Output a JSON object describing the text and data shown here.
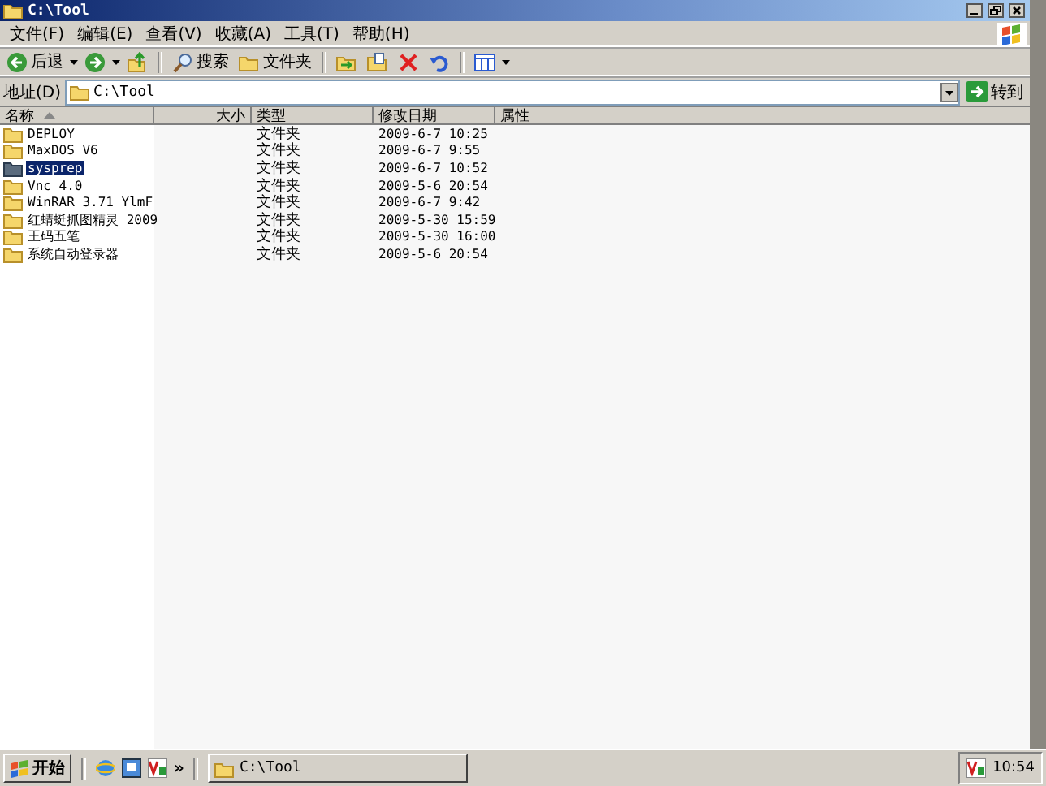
{
  "window": {
    "title": "C:\\Tool"
  },
  "menu": [
    "文件(F)",
    "编辑(E)",
    "查看(V)",
    "收藏(A)",
    "工具(T)",
    "帮助(H)"
  ],
  "toolbar": [
    {
      "kind": "back",
      "label": "后退"
    },
    {
      "kind": "forward"
    },
    {
      "kind": "up"
    },
    {
      "kind": "search",
      "label": "搜索"
    },
    {
      "kind": "folders",
      "label": "文件夹"
    },
    {
      "kind": "move"
    },
    {
      "kind": "copy"
    },
    {
      "kind": "delete"
    },
    {
      "kind": "undo"
    },
    {
      "kind": "views"
    }
  ],
  "address": {
    "label": "地址(D)",
    "value": "C:\\Tool",
    "go": "转到"
  },
  "columns": [
    {
      "label": "名称",
      "sorted": true
    },
    {
      "label": "大小",
      "sorted": false
    },
    {
      "label": "类型",
      "sorted": false
    },
    {
      "label": "修改日期",
      "sorted": false
    },
    {
      "label": "属性",
      "sorted": false
    }
  ],
  "rows": [
    {
      "name": "DEPLOY",
      "type": "文件夹",
      "date": "2009-6-7 10:25",
      "selected": false
    },
    {
      "name": "MaxDOS V6",
      "type": "文件夹",
      "date": "2009-6-7 9:55",
      "selected": false
    },
    {
      "name": "sysprep",
      "type": "文件夹",
      "date": "2009-6-7 10:52",
      "selected": true
    },
    {
      "name": "Vnc 4.0",
      "type": "文件夹",
      "date": "2009-5-6 20:54",
      "selected": false
    },
    {
      "name": "WinRAR_3.71_YlmF",
      "type": "文件夹",
      "date": "2009-6-7 9:42",
      "selected": false
    },
    {
      "name": "红蜻蜓抓图精灵 2009",
      "type": "文件夹",
      "date": "2009-5-30 15:59",
      "selected": false
    },
    {
      "name": "王码五笔",
      "type": "文件夹",
      "date": "2009-5-30 16:00",
      "selected": false
    },
    {
      "name": "系统自动登录器",
      "type": "文件夹",
      "date": "2009-5-6 20:54",
      "selected": false
    }
  ],
  "taskbar": {
    "start": "开始",
    "quick_launch": [
      {
        "kind": "browser"
      },
      {
        "kind": "desktop"
      },
      {
        "kind": "vnc"
      }
    ],
    "more": "»",
    "tasks": [
      {
        "label": "C:\\Tool",
        "selected": false
      }
    ],
    "clock": "10:54"
  }
}
